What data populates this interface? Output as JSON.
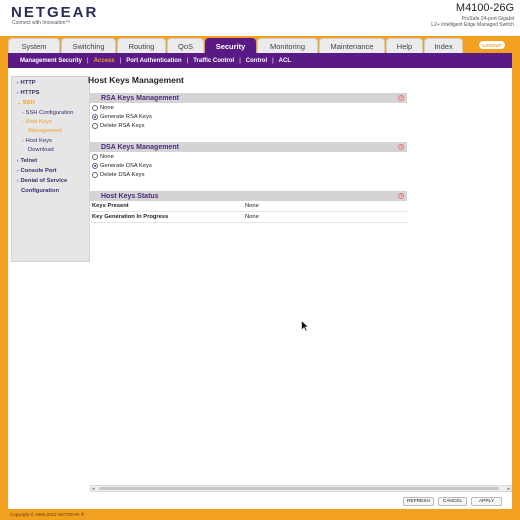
{
  "header": {
    "brand": "NETGEAR",
    "tagline": "Connect with Innovation™",
    "model": "M4100-26G",
    "subtitle_line1": "ProSafe 24-port Gigabit",
    "subtitle_line2": "L2+ Intelligent Edge Managed Switch"
  },
  "tabs": [
    {
      "label": "System"
    },
    {
      "label": "Switching"
    },
    {
      "label": "Routing"
    },
    {
      "label": "QoS"
    },
    {
      "label": "Security"
    },
    {
      "label": "Monitoring"
    },
    {
      "label": "Maintenance"
    },
    {
      "label": "Help"
    },
    {
      "label": "Index"
    }
  ],
  "logout_label": "LOGOUT",
  "subnav": [
    {
      "label": "Management Security"
    },
    {
      "label": "Access"
    },
    {
      "label": "Port Authentication"
    },
    {
      "label": "Traffic Control"
    },
    {
      "label": "Control"
    },
    {
      "label": "ACL"
    }
  ],
  "sidebar": [
    {
      "label": "HTTP"
    },
    {
      "label": "HTTPS"
    },
    {
      "label": "SSH"
    },
    {
      "label": "SSH Configuration"
    },
    {
      "label": "Host Keys"
    },
    {
      "label": "Management"
    },
    {
      "label": "Host Keys"
    },
    {
      "label": "Download"
    },
    {
      "label": "Telnet"
    },
    {
      "label": "Console Port"
    },
    {
      "label": "Denial of Service"
    },
    {
      "label": "Configuration"
    }
  ],
  "page_title": "Host Keys Management",
  "rsa": {
    "title": "RSA Keys Management",
    "options": [
      {
        "label": "None",
        "selected": false
      },
      {
        "label": "Generate RSA Keys",
        "selected": true
      },
      {
        "label": "Delete RSA Keys",
        "selected": false
      }
    ]
  },
  "dsa": {
    "title": "DSA Keys Management",
    "options": [
      {
        "label": "None",
        "selected": false
      },
      {
        "label": "Generate DSA Keys",
        "selected": true
      },
      {
        "label": "Delete DSA Keys",
        "selected": false
      }
    ]
  },
  "status": {
    "title": "Host Keys Status",
    "rows": [
      {
        "key": "Keys Present",
        "value": "None"
      },
      {
        "key": "Key Generation In Progress",
        "value": "None"
      }
    ]
  },
  "buttons": {
    "refresh": "REFRESH",
    "cancel": "CANCEL",
    "apply": "APPLY"
  },
  "footer": "Copyright © 1996-2012 NETGEAR ®",
  "help_glyph": "?",
  "icons": {
    "help": "help-icon",
    "arrow": "arrow-icon",
    "cursor": "mouse-pointer-icon"
  },
  "colors": {
    "accent_orange": "#f1a01f",
    "accent_purple": "#5a1a86",
    "radio_selected": "#1f4fb6"
  }
}
